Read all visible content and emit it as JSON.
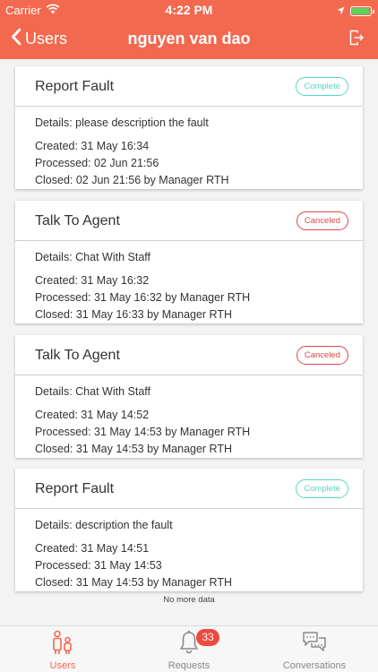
{
  "status_bar": {
    "carrier": "Carrier",
    "time": "4:22 PM",
    "battery_fill_fraction": 0.95
  },
  "nav": {
    "back_label": "Users",
    "title": "nguyen van dao",
    "back_icon": "chevron-left-icon",
    "logout_icon": "logout-icon"
  },
  "requests": [
    {
      "title": "Report Fault",
      "status": "Complete",
      "details": "Details: please description the fault",
      "created": "Created: 31 May 16:34",
      "processed": "Processed: 02 Jun 21:56",
      "closed": "Closed: 02 Jun 21:56 by Manager RTH"
    },
    {
      "title": "Talk To Agent",
      "status": "Canceled",
      "details": "Details: Chat With Staff",
      "created": "Created: 31 May 16:32",
      "processed": "Processed: 31 May 16:32 by Manager RTH",
      "closed": "Closed: 31 May 16:33 by Manager RTH"
    },
    {
      "title": "Talk To Agent",
      "status": "Canceled",
      "details": "Details: Chat With Staff",
      "created": "Created: 31 May 14:52",
      "processed": "Processed: 31 May 14:53 by Manager RTH",
      "closed": "Closed: 31 May 14:53 by Manager RTH"
    },
    {
      "title": "Report Fault",
      "status": "Complete",
      "details": "Details: description the fault",
      "created": "Created: 31 May 14:51",
      "processed": "Processed: 31 May 14:53",
      "closed": "Closed: 31 May 14:53 by Manager RTH"
    }
  ],
  "list_footer": "No more data",
  "tabs": [
    {
      "label": "Users",
      "icon": "users-icon",
      "active": true
    },
    {
      "label": "Requests",
      "icon": "bell-icon",
      "badge": "33",
      "active": false
    },
    {
      "label": "Conversations",
      "icon": "chat-bubbles-icon",
      "active": false
    }
  ],
  "colors": {
    "brand": "#f2694f",
    "complete": "#56d6c4",
    "canceled": "#e0454c",
    "badge": "#ef4a3c",
    "battery": "#5ed35a"
  }
}
